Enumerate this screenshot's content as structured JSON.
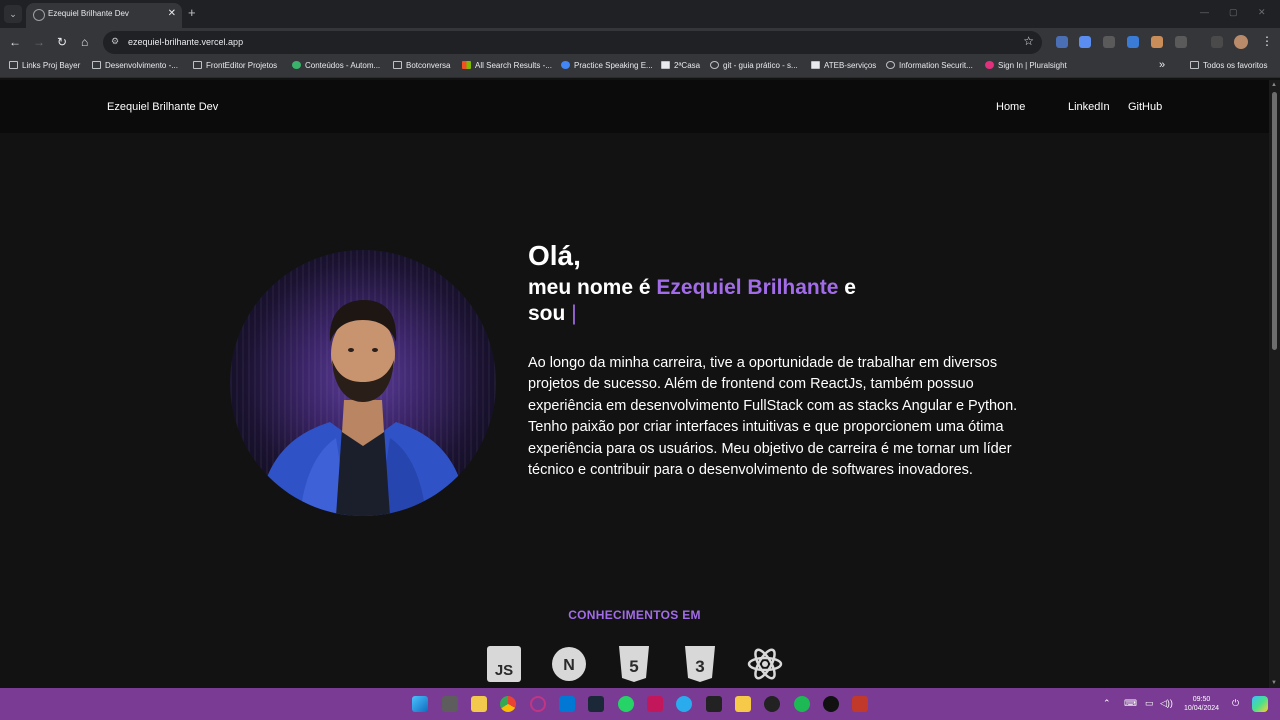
{
  "browser": {
    "tab_title": "Ezequiel Brilhante Dev",
    "url": "ezequiel-brilhante.vercel.app",
    "bookmarks": [
      "Links Proj Bayer",
      "Desenvolvimento -...",
      "FrontEditor Projetos",
      "Conteúdos - Autom...",
      "Botconversa",
      "All Search Results -...",
      "Practice Speaking E...",
      "2ªCasa",
      "git - guia prático - s...",
      "ATEB-serviços",
      "Information Securit...",
      "Sign In | Pluralsight"
    ],
    "all_bookmarks": "Todos os favoritos"
  },
  "site": {
    "brand": "Ezequiel Brilhante Dev",
    "nav": [
      "Home",
      "LinkedIn",
      "GitHub"
    ],
    "hero": {
      "greeting": "Olá,",
      "intro": "meu nome é",
      "name": "Ezequiel Brilhante",
      "conj": "e",
      "sou": "sou",
      "cursor": "|",
      "bio": "Ao longo da minha carreira, tive a oportunidade de trabalhar em diversos projetos de sucesso. Além de frontend com ReactJs, também possuo experiência em desenvolvimento FullStack com as stacks Angular e Python. Tenho paixão por criar interfaces intuitivas e que proporcionem uma ótima experiência para os usuários. Meu objetivo de carreira é me tornar um líder técnico e contribuir para o desenvolvimento de softwares inovadores."
    },
    "skills": {
      "title": "CONHECIMENTOS EM",
      "icons": [
        {
          "name": "javascript-icon",
          "text": "JS"
        },
        {
          "name": "nextjs-icon",
          "text": "N"
        },
        {
          "name": "html5-icon",
          "text": "5"
        },
        {
          "name": "css3-icon",
          "text": "3"
        },
        {
          "name": "react-icon",
          "text": ""
        }
      ]
    },
    "accent_color": "#a26ce8"
  },
  "taskbar": {
    "time": "09:50",
    "date": "10/04/2024",
    "background": "#7a3b94"
  }
}
